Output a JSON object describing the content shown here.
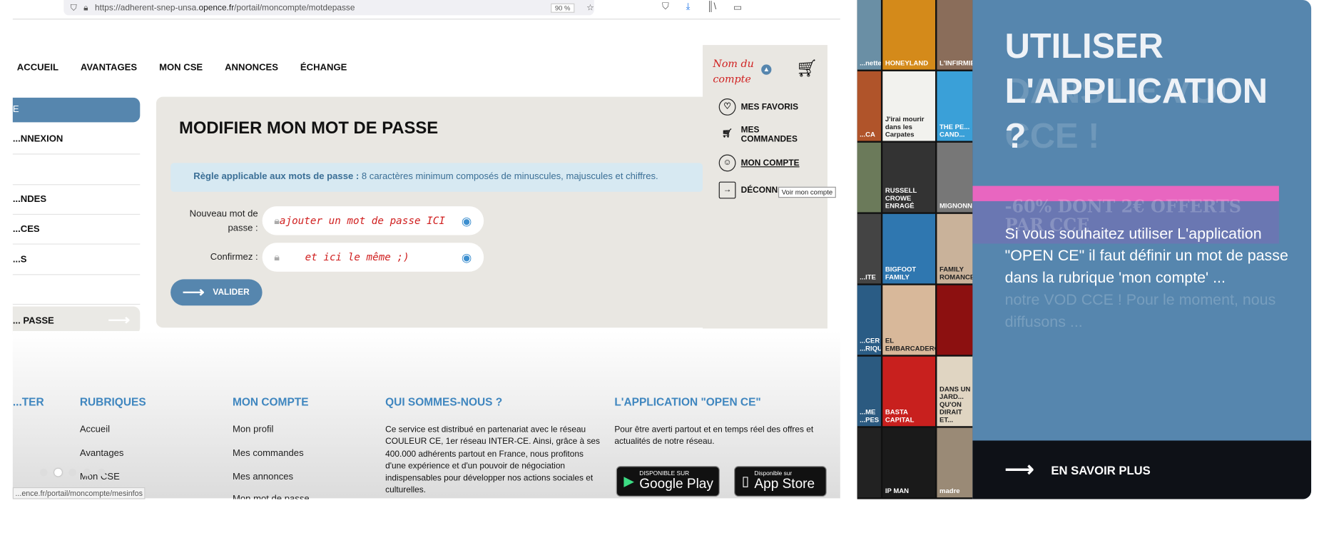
{
  "browser": {
    "url_prefix": "https://adherent-snep-unsa.",
    "url_domain": "opence.fr",
    "url_path": "/portail/moncompte/motdepasse",
    "zoom": "90 %",
    "status_url": "...ence.fr/portail/moncompte/mesinfos"
  },
  "nav": [
    "ACCUEIL",
    "AVANTAGES",
    "MON CSE",
    "ANNONCES",
    "ÉCHANGE"
  ],
  "account": {
    "name": "Nom du compte",
    "menu": [
      "MES FAVORIS",
      "MES COMMANDES",
      "MON COMPTE",
      "DÉCONN..."
    ],
    "tooltip": "Voir mon compte"
  },
  "sidebar": {
    "head": "E",
    "items": [
      "...NNEXION",
      "",
      "...NDES",
      "...CES",
      "...S",
      "",
      "... PASSE"
    ]
  },
  "form": {
    "title": "MODIFIER MON MOT DE PASSE",
    "rule_label": "Règle applicable aux mots de passe :",
    "rule_text": " 8 caractères minimum composés de minuscules, majuscules et chiffres.",
    "new_label": "Nouveau mot de passe :",
    "new_value": "ajouter un mot de passe ICI",
    "confirm_label": "Confirmez :",
    "confirm_value": "et ici le même ;)",
    "submit": "VALIDER"
  },
  "footer": {
    "col0": "...TER",
    "rubriques": {
      "title": "RUBRIQUES",
      "items": [
        "Accueil",
        "Avantages",
        "Mon CSE"
      ]
    },
    "compte": {
      "title": "MON COMPTE",
      "items": [
        "Mon profil",
        "Mes commandes",
        "Mes annonces",
        "Mon mot de passe"
      ]
    },
    "qui": {
      "title": "QUI SOMMES-NOUS ?",
      "text": "Ce service est distribué en partenariat avec le réseau COULEUR CE, 1er réseau INTER-CE. Ainsi, grâce à ses 400.000 adhérents partout en France, nous profitons d'une expérience et d'un pouvoir de négociation indispensables pour développer nos actions sociales et culturelles."
    },
    "app": {
      "title": "L'APPLICATION \"OPEN CE\"",
      "text": "Pour être averti partout et en temps réel des offres et actualités de notre réseau.",
      "google_small": "DISPONIBLE SUR",
      "google": "Google Play",
      "apple_small": "Disponible sur",
      "apple": "App Store"
    }
  },
  "posters": [
    "...nette",
    "HONEYLAND",
    "L'INFIRMIE...",
    "...CA",
    "J'irai mourir dans les Carpates",
    "THE PE... CAND...",
    "",
    "RUSSELL CROWE ENRAGÉ",
    "MIGNONN...",
    "...ITE",
    "BIGFOOT FAMILY",
    "FAMILY ROMANCE",
    "...CER ...RIQUE",
    "EL EMBARCADERO",
    "",
    "...ME ...PES",
    "BASTA CAPITAL",
    "DANS UN JARD... QU'ON DIRAIT ET...",
    "",
    "IP MAN",
    "madre"
  ],
  "panel": {
    "title": "UTILISER L'APPLICATION ?",
    "ghost_title": "DANS LE VOD CCE !",
    "ghost_promo": "-60% DONT 2€ OFFERTS PAR CCE",
    "text": "Si vous souhaitez utiliser L'application \"OPEN CE\" il faut définir un mot de passe dans la rubrique 'mon compte' ...",
    "ghost_text": "notre VOD CCE ! Pour le moment, nous diffusons ...",
    "cta": "EN SAVOIR PLUS",
    "accent": "#5686ae",
    "pink": "#e866c0"
  }
}
